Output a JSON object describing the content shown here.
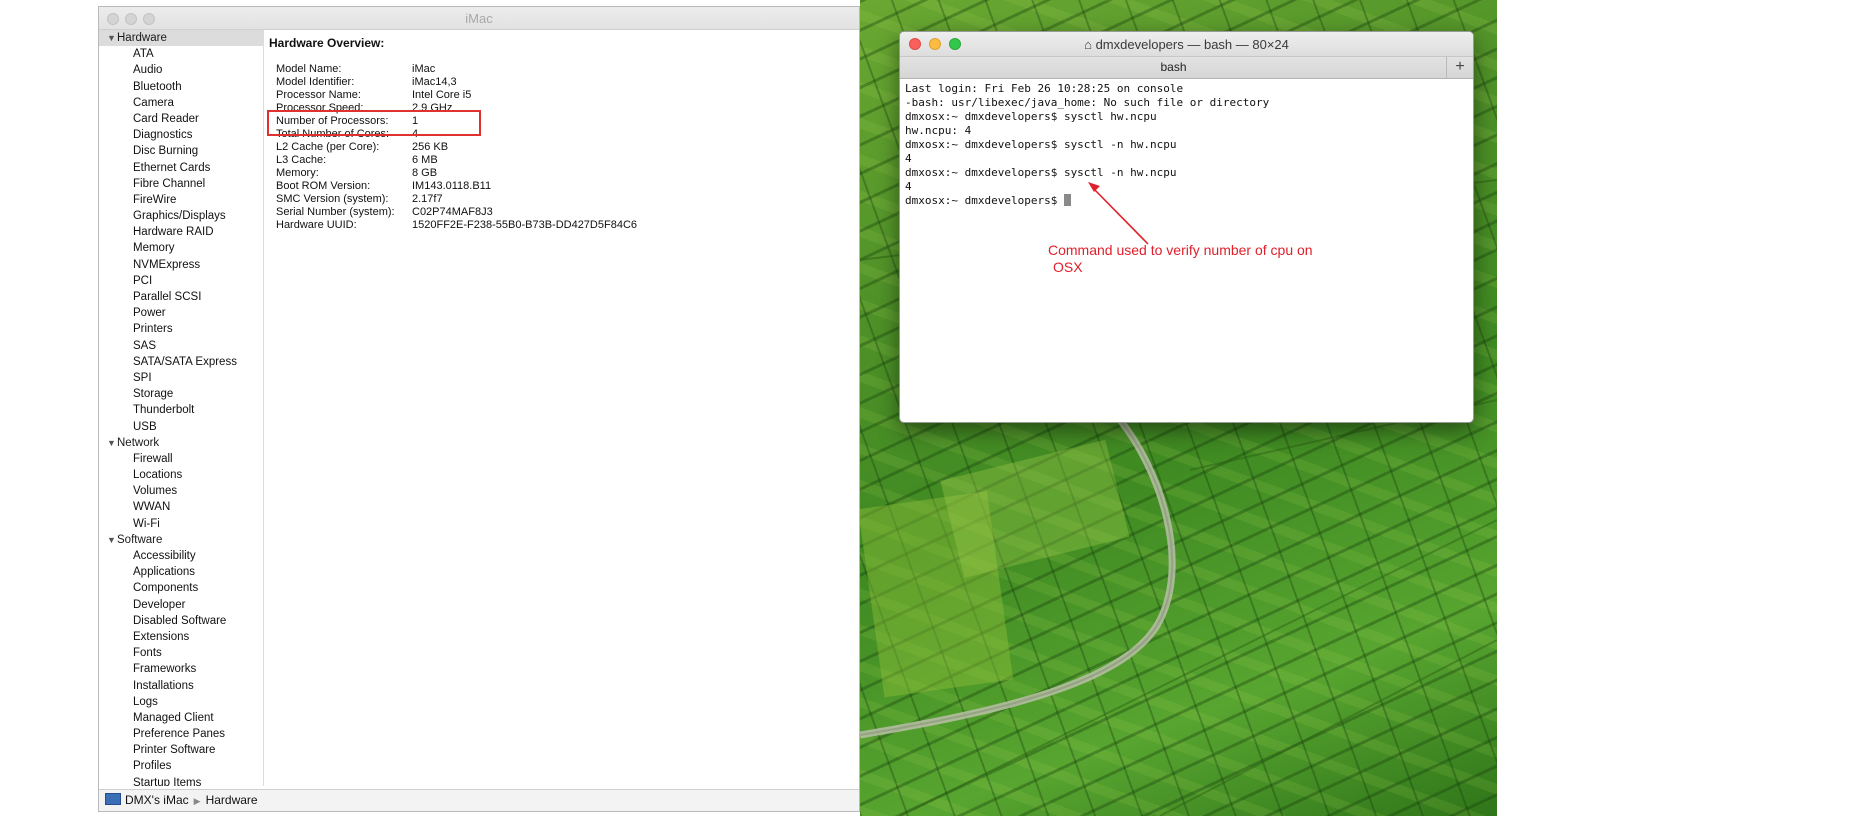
{
  "system_info": {
    "window_title": "iMac",
    "sidebar": {
      "groups": [
        {
          "label": "Hardware",
          "items": [
            "ATA",
            "Audio",
            "Bluetooth",
            "Camera",
            "Card Reader",
            "Diagnostics",
            "Disc Burning",
            "Ethernet Cards",
            "Fibre Channel",
            "FireWire",
            "Graphics/Displays",
            "Hardware RAID",
            "Memory",
            "NVMExpress",
            "PCI",
            "Parallel SCSI",
            "Power",
            "Printers",
            "SAS",
            "SATA/SATA Express",
            "SPI",
            "Storage",
            "Thunderbolt",
            "USB"
          ]
        },
        {
          "label": "Network",
          "items": [
            "Firewall",
            "Locations",
            "Volumes",
            "WWAN",
            "Wi-Fi"
          ]
        },
        {
          "label": "Software",
          "items": [
            "Accessibility",
            "Applications",
            "Components",
            "Developer",
            "Disabled Software",
            "Extensions",
            "Fonts",
            "Frameworks",
            "Installations",
            "Logs",
            "Managed Client",
            "Preference Panes",
            "Printer Software",
            "Profiles",
            "Startup Items"
          ]
        }
      ]
    },
    "detail": {
      "heading": "Hardware Overview:",
      "specs": [
        {
          "label": "Model Name:",
          "value": "iMac"
        },
        {
          "label": "Model Identifier:",
          "value": "iMac14,3"
        },
        {
          "label": "Processor Name:",
          "value": "Intel Core i5"
        },
        {
          "label": "Processor Speed:",
          "value": "2.9 GHz"
        },
        {
          "label": "Number of Processors:",
          "value": "1"
        },
        {
          "label": "Total Number of Cores:",
          "value": "4"
        },
        {
          "label": "L2 Cache (per Core):",
          "value": "256 KB"
        },
        {
          "label": "L3 Cache:",
          "value": "6 MB"
        },
        {
          "label": "Memory:",
          "value": "8 GB"
        },
        {
          "label": "Boot ROM Version:",
          "value": "IM143.0118.B11"
        },
        {
          "label": "SMC Version (system):",
          "value": "2.17f7"
        },
        {
          "label": "Serial Number (system):",
          "value": "C02P74MAF8J3"
        },
        {
          "label": "Hardware UUID:",
          "value": "1520FF2E-F238-55B0-B73B-DD427D5F84C6"
        }
      ]
    },
    "pathbar": {
      "computer": "DMX's iMac",
      "section": "Hardware"
    }
  },
  "terminal": {
    "window_title": "dmxdevelopers — bash — 80×24",
    "tab_label": "bash",
    "new_tab_label": "+",
    "lines": [
      "Last login: Fri Feb 26 10:28:25 on console",
      "-bash: usr/libexec/java_home: No such file or directory",
      "dmxosx:~ dmxdevelopers$ sysctl hw.ncpu",
      "hw.ncpu: 4",
      "dmxosx:~ dmxdevelopers$ sysctl -n hw.ncpu",
      "4",
      "dmxosx:~ dmxdevelopers$ sysctl -n hw.ncpu",
      "4",
      "dmxosx:~ dmxdevelopers$ "
    ]
  },
  "annotation": {
    "line1": "Command used to verify number of cpu on",
    "line2": "OSX",
    "color": "#e0202a"
  }
}
